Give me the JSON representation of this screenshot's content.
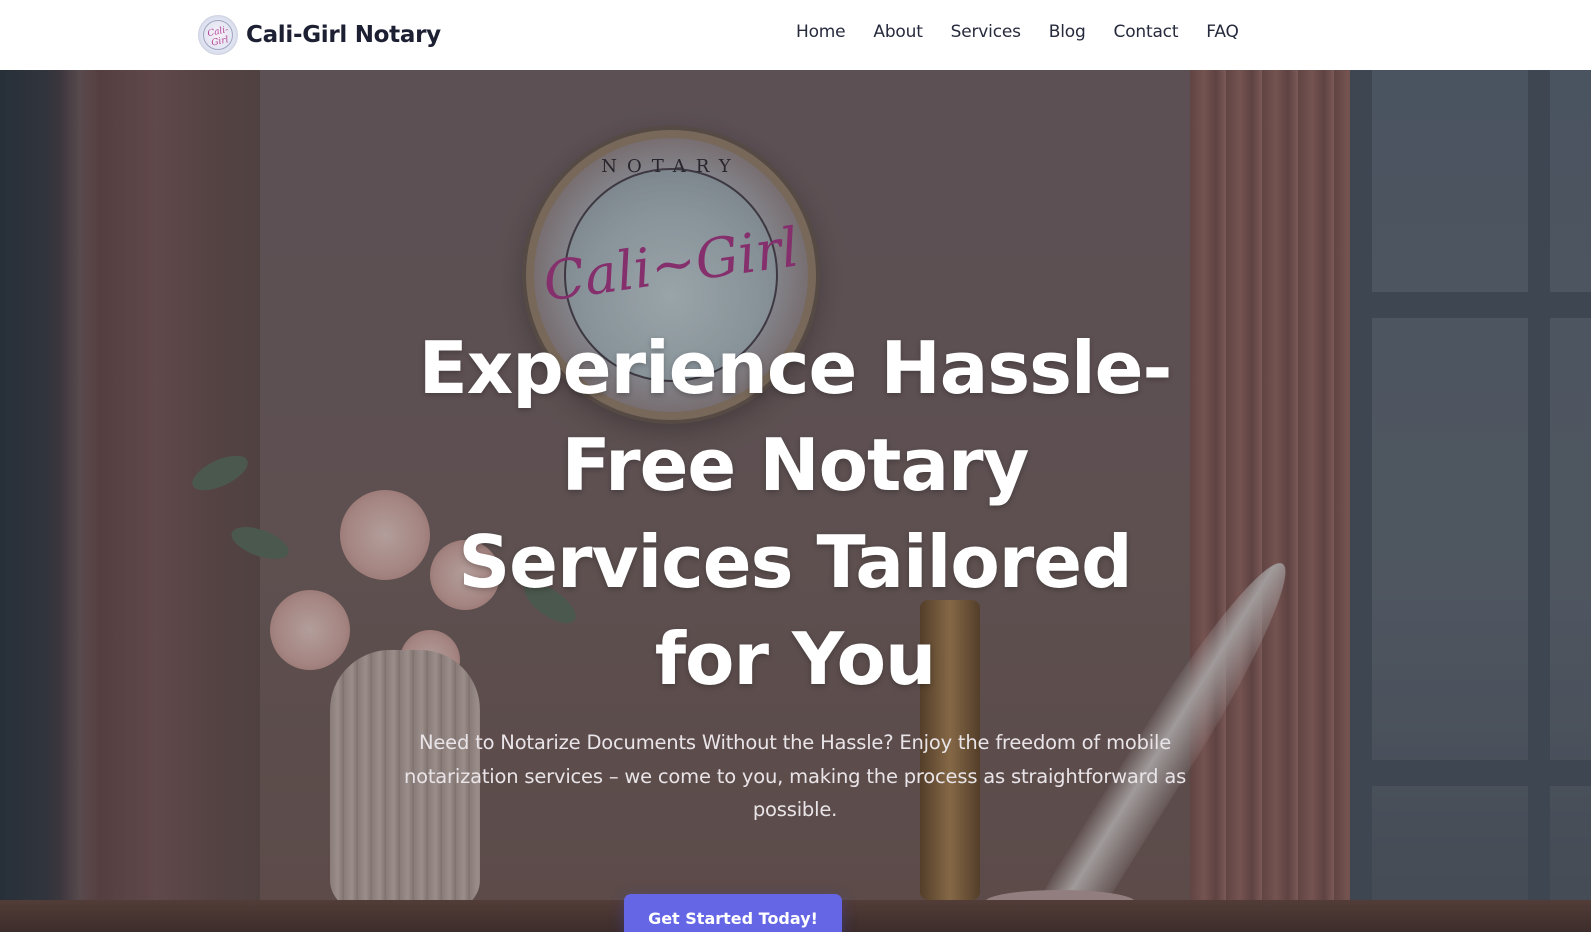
{
  "header": {
    "brand_name": "Cali-Girl Notary",
    "logo_text": "Cali-Girl",
    "nav": [
      {
        "label": "Home"
      },
      {
        "label": "About"
      },
      {
        "label": "Services"
      },
      {
        "label": "Blog"
      },
      {
        "label": "Contact"
      },
      {
        "label": "FAQ"
      }
    ]
  },
  "hero": {
    "title_lines": [
      "Experience Hassle-",
      "Free Notary",
      "Services Tailored",
      "for You"
    ],
    "subtitle": "Need to Notarize Documents Without the Hassle? Enjoy the freedom of mobile notarization services – we come to you, making the process as straightforward as possible.",
    "cta_label": "Get Started Today!",
    "background_seal": {
      "top_text": "NOTARY",
      "script_text": "Cali~Girl"
    }
  },
  "colors": {
    "header_bg": "#ffffff",
    "brand_text": "#1d1f33",
    "cta_bg": "#6466e6",
    "hero_text": "#ffffff"
  },
  "icons": {
    "logo": "cali-girl-notary-seal-logo"
  }
}
